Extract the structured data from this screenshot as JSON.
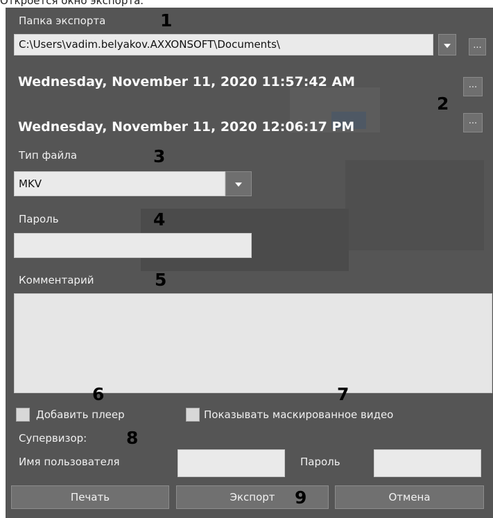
{
  "caption": "Откроется окно экспорта.",
  "export_folder": {
    "label": "Папка экспорта",
    "value": "C:\\Users\\vadim.belyakov.AXXONSOFT\\Documents\\",
    "browse_label": "..."
  },
  "time_range": {
    "start": "Wednesday, November 11, 2020 11:57:42 AM",
    "end": "Wednesday, November 11, 2020 12:06:17 PM",
    "start_button": "...",
    "end_button": "..."
  },
  "file_type": {
    "label": "Тип файла",
    "value": "MKV"
  },
  "password": {
    "label": "Пароль",
    "value": ""
  },
  "comment": {
    "label": "Комментарий",
    "value": ""
  },
  "options": {
    "add_player": {
      "label": "Добавить плеер",
      "checked": false
    },
    "show_masked": {
      "label": "Показывать маскированное видео",
      "checked": false
    }
  },
  "supervisor": {
    "label": "Супервизор:",
    "username_label": "Имя пользователя",
    "username_value": "",
    "password_label": "Пароль",
    "password_value": ""
  },
  "buttons": {
    "print": "Печать",
    "export": "Экспорт",
    "cancel": "Отмена"
  },
  "callouts": [
    "1",
    "2",
    "3",
    "4",
    "5",
    "6",
    "7",
    "8",
    "9"
  ]
}
